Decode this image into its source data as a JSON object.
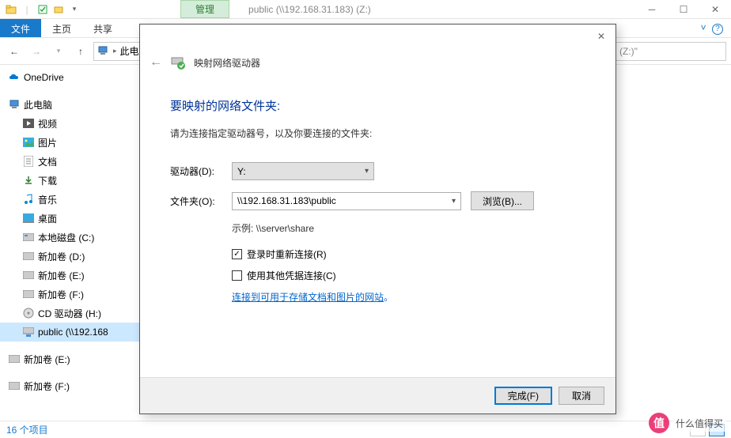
{
  "titlebar": {
    "management": "管理",
    "title": "public (\\\\192.168.31.183) (Z:)"
  },
  "ribbon": {
    "file": "文件",
    "home": "主页",
    "share": "共享"
  },
  "nav": {
    "breadcrumb": "此电",
    "search_placeholder": "(Z:)\""
  },
  "tree": {
    "onedrive": "OneDrive",
    "thispc": "此电脑",
    "videos": "视频",
    "pictures": "图片",
    "documents": "文档",
    "downloads": "下载",
    "music": "音乐",
    "desktop": "桌面",
    "localdisk": "本地磁盘 (C:)",
    "volD": "新加卷 (D:)",
    "volE": "新加卷 (E:)",
    "volF": "新加卷 (F:)",
    "cdrom": "CD 驱动器 (H:)",
    "public": "public (\\\\192.168",
    "volE2": "新加卷 (E:)",
    "volF2": "新加卷 (F:)"
  },
  "status": {
    "items": "16 个项目"
  },
  "dialog": {
    "title": "映射网络驱动器",
    "heading": "要映射的网络文件夹:",
    "instruction": "请为连接指定驱动器号，以及你要连接的文件夹:",
    "drive_label": "驱动器(D):",
    "drive_value": "Y:",
    "folder_label": "文件夹(O):",
    "folder_value": "\\\\192.168.31.183\\public",
    "browse": "浏览(B)...",
    "example": "示例: \\\\server\\share",
    "reconnect": "登录时重新连接(R)",
    "other_creds": "使用其他凭据连接(C)",
    "link": "连接到可用于存储文档和图片的网站",
    "finish": "完成(F)",
    "cancel": "取消"
  },
  "watermark": {
    "char": "值",
    "text": "什么值得买"
  }
}
